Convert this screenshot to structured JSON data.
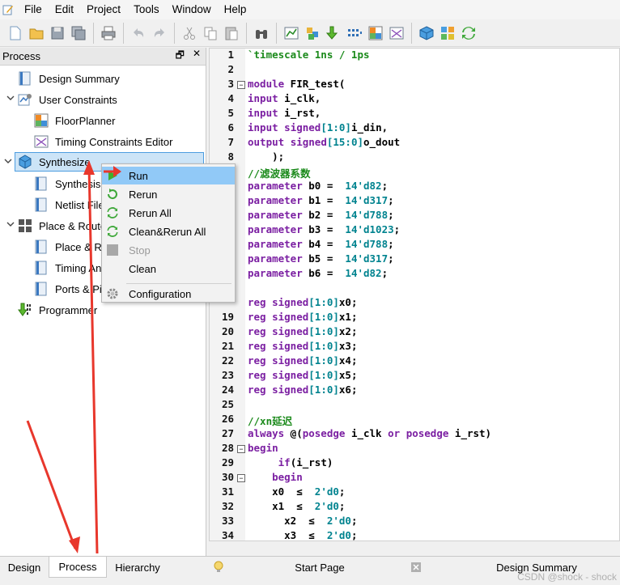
{
  "menubar": {
    "items": [
      "File",
      "Edit",
      "Project",
      "Tools",
      "Window",
      "Help"
    ]
  },
  "toolbar": {
    "icons": [
      "new-file-icon",
      "open-folder-icon",
      "save-icon",
      "save-all-icon",
      "print-icon",
      "undo-icon",
      "redo-icon",
      "cut-icon",
      "copy-icon",
      "paste-icon",
      "binoculars-icon",
      "synthesis-report-icon",
      "place-route-icon",
      "programmer-icon",
      "netlist-icon",
      "floorplanner-icon",
      "timing-icon",
      "package-icon",
      "gear-group-icon",
      "refresh-icon"
    ]
  },
  "process_panel": {
    "title": "Process",
    "tree": [
      {
        "label": "Design Summary"
      },
      {
        "label": "User Constraints"
      },
      {
        "label": "FloorPlanner"
      },
      {
        "label": "Timing Constraints Editor"
      },
      {
        "label": "Synthesize"
      },
      {
        "label": "Synthesis"
      },
      {
        "label": "Netlist File"
      },
      {
        "label": "Place & Route"
      },
      {
        "label": "Place & R"
      },
      {
        "label": "Timing An"
      },
      {
        "label": "Ports & Pi"
      },
      {
        "label": "Programmer"
      }
    ]
  },
  "context_menu": {
    "items": [
      {
        "label": "Run",
        "state": "highlighted"
      },
      {
        "label": "Rerun"
      },
      {
        "label": "Rerun All"
      },
      {
        "label": "Clean&Rerun All"
      },
      {
        "label": "Stop",
        "state": "disabled"
      },
      {
        "label": "Clean"
      },
      {
        "label": "Configuration"
      }
    ]
  },
  "editor": {
    "lines": [
      {
        "n": "1",
        "text": "`timescale 1ns / 1ps"
      },
      {
        "n": "2",
        "text": ""
      },
      {
        "n": "3",
        "text": "module FIR_test("
      },
      {
        "n": "4",
        "text": "input i_clk,"
      },
      {
        "n": "5",
        "text": "input i_rst,"
      },
      {
        "n": "6",
        "text": "input signed[1:0]i_din,"
      },
      {
        "n": "7",
        "text": "output signed[15:0]o_dout"
      },
      {
        "n": "8",
        "text": "    );"
      },
      {
        "n": "",
        "text": "//滤波器系数"
      },
      {
        "n": "",
        "text": "parameter b0 =  14'd82;"
      },
      {
        "n": "",
        "text": "parameter b1 =  14'd317;"
      },
      {
        "n": "",
        "text": "parameter b2 =  14'd788;"
      },
      {
        "n": "",
        "text": "parameter b3 =  14'd1023;"
      },
      {
        "n": "",
        "text": "parameter b4 =  14'd788;"
      },
      {
        "n": "",
        "text": "parameter b5 =  14'd317;"
      },
      {
        "n": "",
        "text": "parameter b6 =  14'd82;"
      },
      {
        "n": "",
        "text": ""
      },
      {
        "n": "",
        "text": "reg signed[1:0]x0;"
      },
      {
        "n": "19",
        "text": "reg signed[1:0]x1;"
      },
      {
        "n": "20",
        "text": "reg signed[1:0]x2;"
      },
      {
        "n": "21",
        "text": "reg signed[1:0]x3;"
      },
      {
        "n": "22",
        "text": "reg signed[1:0]x4;"
      },
      {
        "n": "23",
        "text": "reg signed[1:0]x5;"
      },
      {
        "n": "24",
        "text": "reg signed[1:0]x6;"
      },
      {
        "n": "25",
        "text": ""
      },
      {
        "n": "26",
        "text": "//xn延迟"
      },
      {
        "n": "27",
        "text": "always @(posedge i_clk or posedge i_rst)"
      },
      {
        "n": "28",
        "text": "begin"
      },
      {
        "n": "29",
        "text": "     if(i_rst)"
      },
      {
        "n": "30",
        "text": "    begin"
      },
      {
        "n": "31",
        "text": "    x0  ≤  2'd0;"
      },
      {
        "n": "32",
        "text": "    x1  ≤  2'd0;"
      },
      {
        "n": "33",
        "text": "      x2  ≤  2'd0;"
      },
      {
        "n": "34",
        "text": "      x3  ≤  2'd0;"
      }
    ]
  },
  "bottom_tabs": {
    "left": [
      "Design",
      "Process",
      "Hierarchy"
    ],
    "right": [
      "Start Page",
      "Design Summary"
    ]
  },
  "watermark": "CSDN @shock - shock",
  "colors": {
    "annotation_arrow": "#e8372c",
    "selection": "#cce4f7",
    "menu_highlight": "#91c9f7"
  }
}
